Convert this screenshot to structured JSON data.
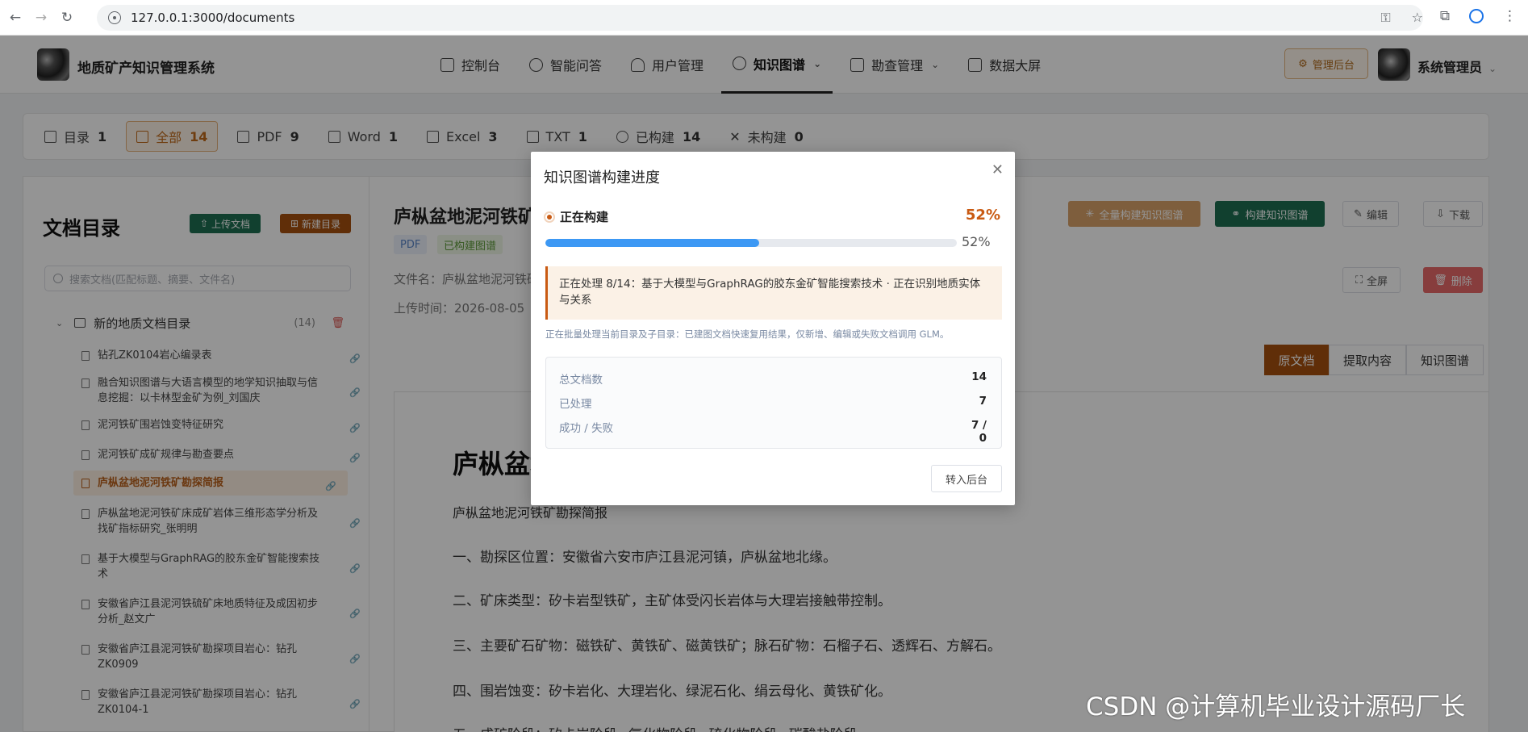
{
  "browser": {
    "url": "127.0.0.1:3000/documents"
  },
  "header": {
    "brand": "地质矿产知识管理系统",
    "nav": [
      {
        "label": "控制台",
        "icon": "monitor-icon"
      },
      {
        "label": "智能问答",
        "icon": "chat-icon"
      },
      {
        "label": "用户管理",
        "icon": "user-icon"
      },
      {
        "label": "知识图谱",
        "icon": "graph-icon"
      },
      {
        "label": "勘查管理",
        "icon": "folder-icon"
      },
      {
        "label": "数据大屏",
        "icon": "screen-icon"
      }
    ],
    "admin_button": "管理后台",
    "user_name": "系统管理员"
  },
  "filters": [
    {
      "label": "目录",
      "count": "1"
    },
    {
      "label": "全部",
      "count": "14"
    },
    {
      "label": "PDF",
      "count": "9"
    },
    {
      "label": "Word",
      "count": "1"
    },
    {
      "label": "Excel",
      "count": "3"
    },
    {
      "label": "TXT",
      "count": "1"
    },
    {
      "label": "已构建",
      "count": "14"
    },
    {
      "label": "未构建",
      "count": "0"
    }
  ],
  "sidebar": {
    "title": "文档目录",
    "upload_button": "上传文档",
    "new_folder_button": "新建目录",
    "search_placeholder": "搜索文档(匹配标题、摘要、文件名)",
    "folder": {
      "name": "新的地质文档目录",
      "count": "(14)"
    },
    "docs": [
      "钻孔ZK0104岩心编录表",
      "融合知识图谱与大语言模型的地学知识抽取与信息挖掘：以卡林型金矿为例_刘国庆",
      "泥河铁矿围岩蚀变特征研究",
      "泥河铁矿成矿规律与勘查要点",
      "庐枞盆地泥河铁矿勘探简报",
      "庐枞盆地泥河铁矿床成矿岩体三维形态学分析及找矿指标研究_张明明",
      "基于大模型与GraphRAG的胶东金矿智能搜索技术",
      "安徽省庐江县泥河铁硫矿床地质特征及成因初步分析_赵文广",
      "安徽省庐江县泥河铁矿勘探项目岩心：钻孔ZK0909",
      "安徽省庐江县泥河铁矿勘探项目岩心：钻孔ZK0104-1"
    ]
  },
  "document": {
    "title": "庐枞盆地泥河铁矿勘探简报",
    "type_badge": "PDF",
    "status_badge": "已构建图谱",
    "filename": "文件名：庐枞盆地泥河铁矿勘探简报",
    "upload_time": "上传时间：2026-08-05",
    "buttons": {
      "build_all": "全量构建知识图谱",
      "build": "构建知识图谱",
      "edit": "编辑",
      "download": "下载",
      "fullscreen": "全屏",
      "delete": "删除"
    },
    "tabs": [
      "原文档",
      "提取内容",
      "知识图谱"
    ],
    "heading": "庐枞盆地泥河铁矿勘探简报",
    "lines": [
      "庐枞盆地泥河铁矿勘探简报",
      "一、勘探区位置：安徽省六安市庐江县泥河镇，庐枞盆地北缘。",
      "二、矿床类型：矽卡岩型铁矿，主矿体受闪长岩体与大理岩接触带控制。",
      "三、主要矿石矿物：磁铁矿、黄铁矿、磁黄铁矿；脉石矿物：石榴子石、透辉石、方解石。",
      "四、围岩蚀变：矽卡岩化、大理岩化、绿泥石化、绢云母化、黄铁矿化。",
      "五、成矿阶段：矽卡岩阶段→氧化物阶段→硫化物阶段→碳酸盐阶段"
    ]
  },
  "modal": {
    "title": "知识图谱构建进度",
    "status": "正在构建",
    "percent_label": "52%",
    "progress": 0.52,
    "alert": "正在处理 8/14：基于大模型与GraphRAG的胶东金矿智能搜索技术 · 正在识别地质实体与关系",
    "note": "正在批量处理当前目录及子目录：已建图文档快速复用结果，仅新增、编辑或失败文档调用 GLM。",
    "stats": [
      {
        "label": "总文档数",
        "value": "14"
      },
      {
        "label": "已处理",
        "value": "7"
      },
      {
        "label": "成功 / 失败",
        "value": "7 / 0"
      }
    ],
    "background_button": "转入后台"
  },
  "watermark": "CSDN @计算机毕业设计源码厂长",
  "colors": {
    "accent": "#c95a12",
    "progress": "#3c98f4",
    "green": "#1e6e52",
    "danger": "#e86a6a"
  }
}
